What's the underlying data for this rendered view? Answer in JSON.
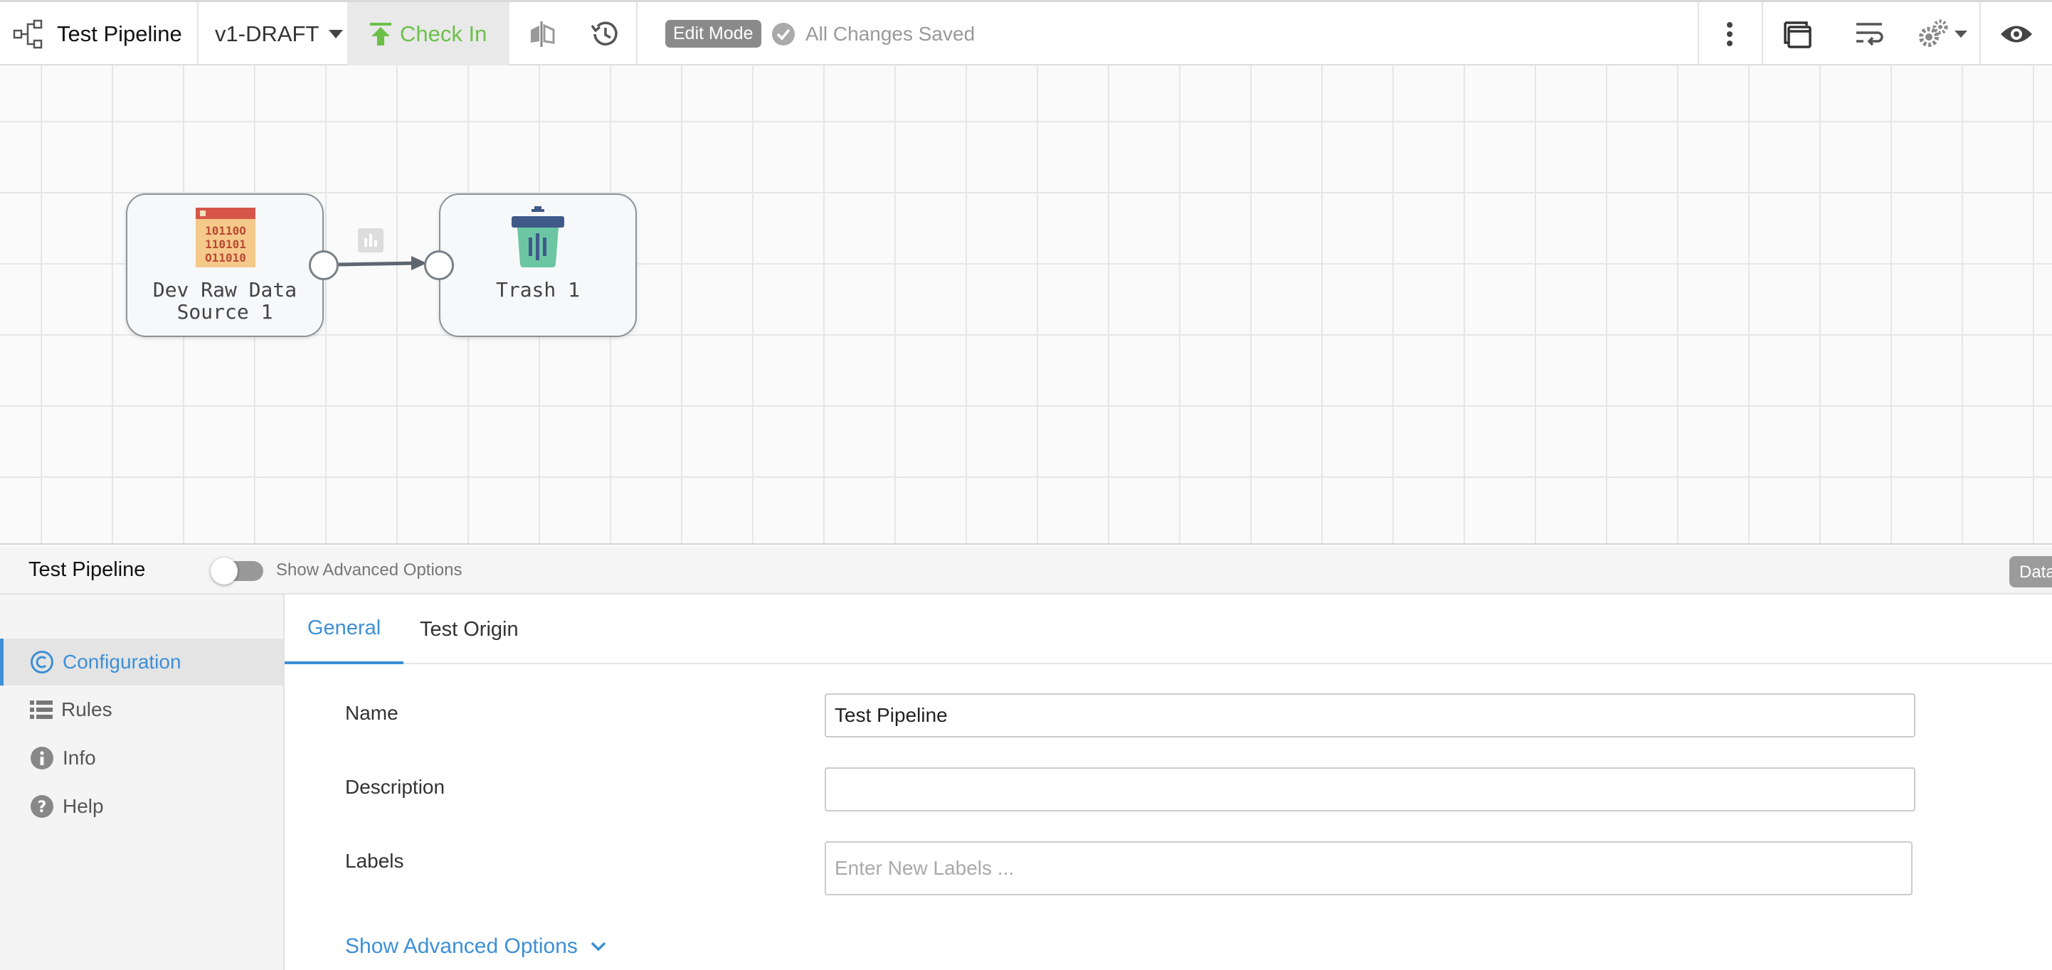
{
  "toolbar": {
    "pipeline_title": "Test Pipeline",
    "version": "v1-DRAFT",
    "check_in_label": "Check In",
    "edit_mode_label": "Edit Mode",
    "save_status": "All Changes Saved"
  },
  "canvas": {
    "stages": [
      {
        "label_line1": "Dev Raw Data",
        "label_line2": "Source 1",
        "icon": "binary-data-source-icon"
      },
      {
        "label_line1": "Trash 1",
        "icon": "trash-icon"
      }
    ]
  },
  "panel": {
    "title": "Test Pipeline",
    "advanced_toggle_label": "Show Advanced Options",
    "data_tab_label": "Data"
  },
  "sidebar": {
    "items": [
      {
        "label": "Configuration",
        "icon": "copyright-c-icon",
        "active": true
      },
      {
        "label": "Rules",
        "icon": "list-icon"
      },
      {
        "label": "Info",
        "icon": "info-icon"
      },
      {
        "label": "Help",
        "icon": "help-icon"
      }
    ]
  },
  "tabs": [
    {
      "label": "General",
      "active": true
    },
    {
      "label": "Test Origin"
    }
  ],
  "form": {
    "name_label": "Name",
    "name_value": "Test Pipeline",
    "description_label": "Description",
    "description_value": "",
    "labels_label": "Labels",
    "labels_placeholder": "Enter New Labels ...",
    "advanced_link": "Show Advanced Options"
  },
  "colors": {
    "accent": "#3d8fd6",
    "check_in_green": "#6cc04a",
    "source_red": "#d6574a",
    "trash_teal": "#6cc6a4"
  }
}
